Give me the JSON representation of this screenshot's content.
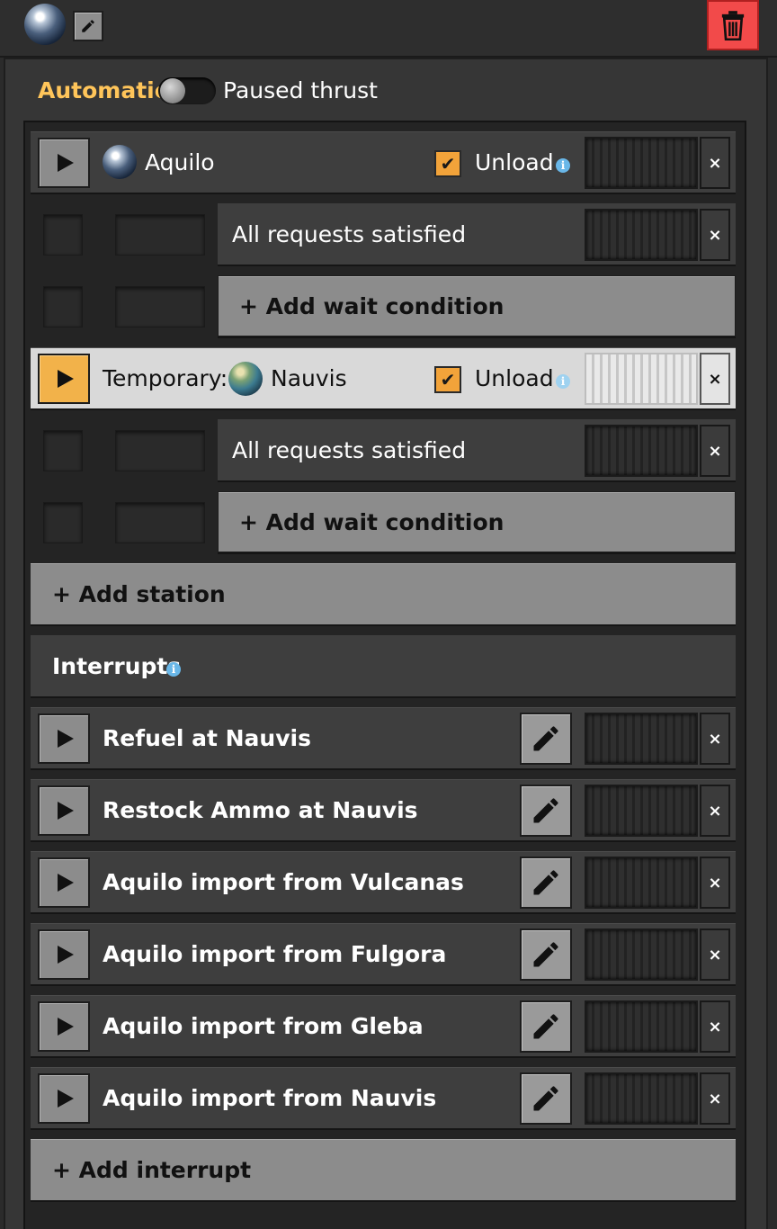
{
  "header": {
    "planet_icon": "aquilo-planet-icon",
    "edit_icon": "pencil-icon",
    "delete_icon": "trash-icon",
    "delete_color": "#f24a4a"
  },
  "mode": {
    "automatic_label": "Automatic",
    "paused_label": "Paused thrust",
    "toggle_on": false,
    "accent_color": "#ffc55a"
  },
  "schedule": {
    "stations": [
      {
        "prefix": "",
        "name": "Aquilo",
        "planet_icon": "aquilo-planet-icon",
        "unload_label": "Unload",
        "unload_checked": true,
        "highlighted": false,
        "conditions": [
          "All requests satisfied"
        ],
        "add_condition_label": "+ Add wait condition"
      },
      {
        "prefix": "Temporary:",
        "name": "Nauvis",
        "planet_icon": "nauvis-planet-icon",
        "unload_label": "Unload",
        "unload_checked": true,
        "highlighted": true,
        "conditions": [
          "All requests satisfied"
        ],
        "add_condition_label": "+ Add wait condition"
      }
    ],
    "add_station_label": "+ Add station",
    "close_glyph": "×"
  },
  "interrupts": {
    "title": "Interrupts",
    "items": [
      "Refuel at Nauvis",
      "Restock Ammo at Nauvis",
      "Aquilo import from Vulcanas",
      "Aquilo import from Fulgora",
      "Aquilo import from Gleba",
      "Aquilo import from Nauvis"
    ],
    "add_label": "+ Add interrupt"
  }
}
